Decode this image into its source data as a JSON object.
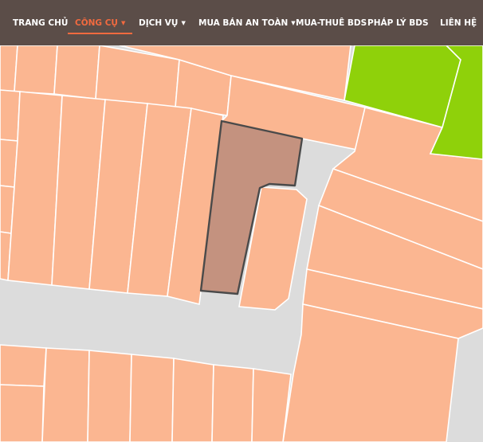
{
  "nav": {
    "items": [
      {
        "label": "TRANG CHỦ",
        "has_caret": false,
        "active": false
      },
      {
        "label": "CÔNG CỤ",
        "has_caret": true,
        "active": true
      },
      {
        "label": "DỊCH VỤ",
        "has_caret": true,
        "active": false
      },
      {
        "label": "MUA BÁN AN TOÀN",
        "has_caret": true,
        "active": false
      },
      {
        "label": "MUA-THUÊ BDS",
        "has_caret": false,
        "active": false
      },
      {
        "label": "PHÁP LÝ BDS",
        "has_caret": false,
        "active": false
      },
      {
        "label": "LIÊN HỆ",
        "has_caret": false,
        "active": false
      }
    ],
    "caret_glyph": "▼"
  },
  "colors": {
    "nav_bg": "#5b4d48",
    "nav_text": "#ffffff",
    "nav_active": "#f26a3f",
    "parcel": "#fbb691",
    "parcel_border": "#ffffff",
    "road": "#dcdcdc",
    "green_area": "#8fd10a",
    "selected_parcel": "#c4927f",
    "selected_border": "#4a4a4a"
  }
}
